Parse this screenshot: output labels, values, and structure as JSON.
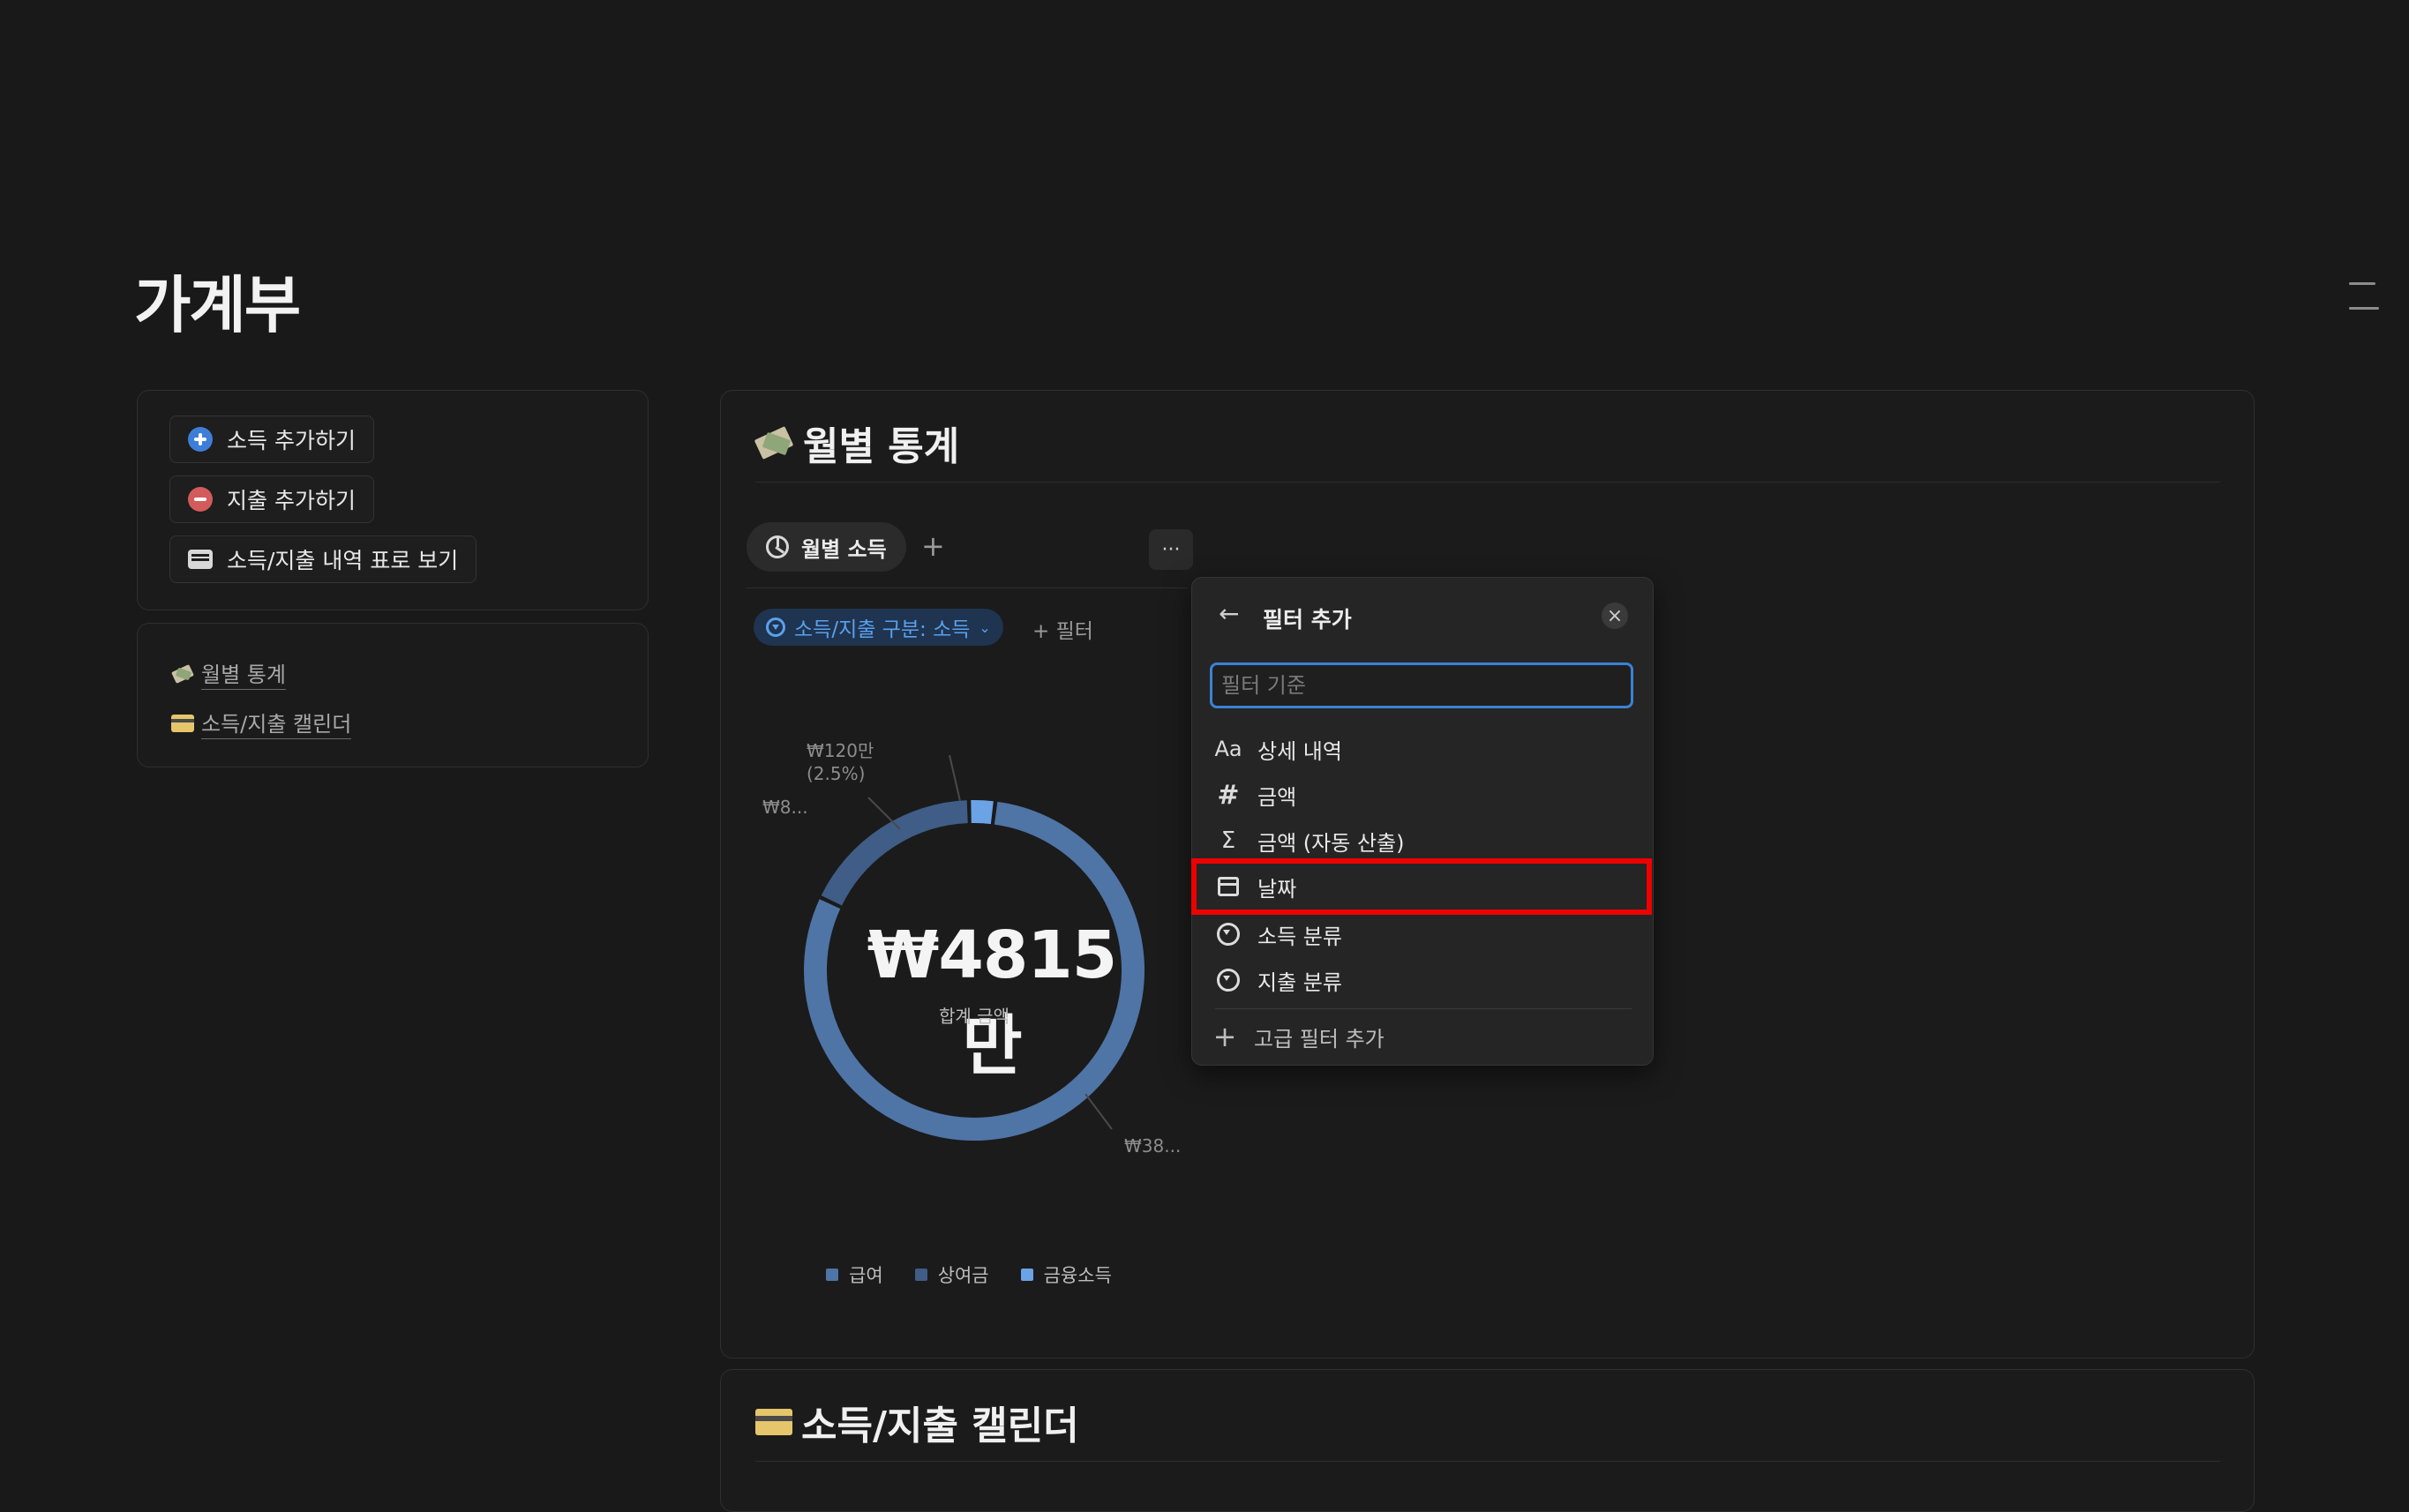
{
  "page": {
    "title": "가계부"
  },
  "sidebar": {
    "buttons": [
      {
        "label": "소득 추가하기",
        "icon": "plus-circle-icon",
        "color": "#3f7ed8"
      },
      {
        "label": "지출 추가하기",
        "icon": "minus-circle-icon",
        "color": "#d35b5b"
      },
      {
        "label": "소득/지출 내역 표로 보기",
        "icon": "credit-card-icon"
      }
    ],
    "links": [
      {
        "label": "월별 통계",
        "icon": "money-wings-icon"
      },
      {
        "label": "소득/지출 캘린더",
        "icon": "credit-card-emoji-icon"
      }
    ]
  },
  "stats": {
    "title": "월별 통계",
    "tab_label": "월별 소득",
    "add_tab": "+",
    "more": "···",
    "filter_chip": "소득/지출 구분: 소득",
    "add_filter": "+ 필터",
    "total_value": "₩4815만",
    "total_caption": "합계 금액",
    "callouts": {
      "top_value": "₩120만",
      "top_pct": "(2.5%)",
      "left": "₩8...",
      "bottom": "₩38..."
    }
  },
  "chart_data": {
    "type": "pie",
    "variant": "donut",
    "center_text": "₩4815만",
    "center_caption": "합계 금액",
    "unit": "만원",
    "total": 4815,
    "series": [
      {
        "name": "급여",
        "value": 3855,
        "color": "#4f74a6"
      },
      {
        "name": "상여금",
        "value": 840,
        "color": "#3f5d86"
      },
      {
        "name": "금융소득",
        "value": 120,
        "color": "#6aa3e6",
        "percent": 2.5
      }
    ],
    "legend": [
      "급여",
      "상여금",
      "금융소득"
    ],
    "legend_position": "bottom"
  },
  "filter_menu": {
    "title": "필터 추가",
    "back": "←",
    "close": "×",
    "search_placeholder": "필터 기준",
    "options": [
      {
        "label": "상세 내역",
        "icon": "Aa"
      },
      {
        "label": "금액",
        "icon": "#"
      },
      {
        "label": "금액 (자동 산출)",
        "icon": "Σ"
      },
      {
        "label": "날짜",
        "icon": "calendar-icon"
      },
      {
        "label": "소득 분류",
        "icon": "select-icon"
      },
      {
        "label": "지출 분류",
        "icon": "select-icon"
      }
    ],
    "advanced": "고급 필터 추가",
    "advanced_icon": "+"
  },
  "calendar": {
    "title": "소득/지출 캘린더"
  }
}
